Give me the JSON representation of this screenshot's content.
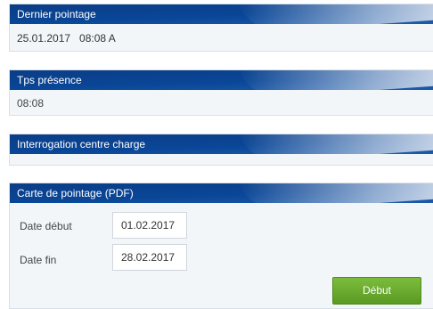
{
  "panels": {
    "last_punch": {
      "title": "Dernier pointage",
      "value": "25.01.2017   08:08 A"
    },
    "presence": {
      "title": "Tps présence",
      "value": "08:08"
    },
    "cost_center": {
      "title": "Interrogation centre charge",
      "value": ""
    },
    "timecard": {
      "title": "Carte de pointage (PDF)",
      "start_label": "Date début",
      "start_value": "01.02.2017",
      "end_label": "Date fin",
      "end_value": "28.02.2017",
      "button_label": "Début"
    }
  },
  "colors": {
    "header_blue": "#0a4697",
    "button_green": "#6aab2e",
    "panel_bg": "#f3f6f9"
  }
}
